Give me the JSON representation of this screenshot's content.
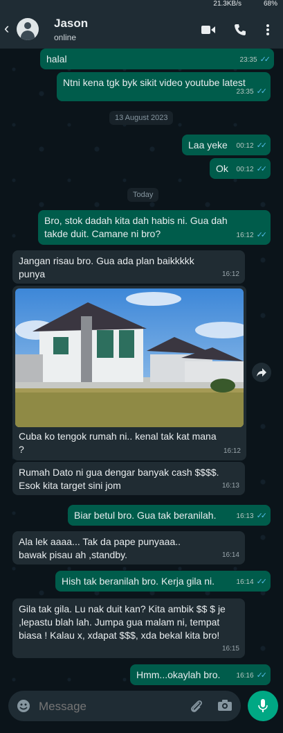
{
  "status_bar": {
    "network": "21.3KB/s",
    "battery": "68%"
  },
  "header": {
    "name": "Jason",
    "status": "online"
  },
  "messages": [
    {
      "dir": "out",
      "text": "halal",
      "time": "23:35"
    },
    {
      "dir": "out",
      "text": "Ntni kena tgk byk sikit video youtube latest",
      "time": "23:35"
    },
    {
      "dir": "out",
      "text": "Laa yeke",
      "time": "00:12"
    },
    {
      "dir": "out",
      "text": "Ok",
      "time": "00:12"
    },
    {
      "dir": "out",
      "text": "Bro, stok dadah kita dah habis ni. Gua dah takde duit. Camane ni bro?",
      "time": "16:12"
    },
    {
      "dir": "in",
      "text": "Jangan risau bro. Gua ada plan baikkkkk punya",
      "time": "16:12"
    },
    {
      "dir": "in",
      "text": "Cuba ko tengok rumah ni.. kenal tak kat mana ?",
      "time": "16:12"
    },
    {
      "dir": "in",
      "text": "Rumah Dato ni gua dengar banyak cash $$$$. Esok kita target sini jom",
      "time": "16:13"
    },
    {
      "dir": "out",
      "text": "Biar betul bro. Gua tak beranilah.",
      "time": "16:13"
    },
    {
      "dir": "in",
      "text": "Ala lek aaaa... Tak da pape punyaaa.. bawak pisau ah ,standby.",
      "time": "16:14"
    },
    {
      "dir": "out",
      "text": "Hish tak beranilah bro. Kerja gila ni.",
      "time": "16:14"
    },
    {
      "dir": "in",
      "text": "Gila tak gila. Lu nak duit kan? Kita ambik $$ $ je ,lepastu blah lah. Jumpa gua malam ni, tempat biasa ! Kalau x, xdapat $$$, xda bekal kita bro!",
      "time": "16:15"
    },
    {
      "dir": "out",
      "text": "Hmm...okaylah bro.",
      "time": "16:16"
    }
  ],
  "dates": {
    "d1": "13 August 2023",
    "d2": "Today"
  },
  "input": {
    "placeholder": "Message"
  },
  "icons": [
    "back-arrow-icon",
    "video-call-icon",
    "phone-icon",
    "more-icon",
    "forward-icon",
    "emoji-icon",
    "attach-icon",
    "camera-icon",
    "mic-icon"
  ],
  "colors": {
    "outgoing": "#005c4b",
    "incoming": "#202c33",
    "accent": "#00a884",
    "read_tick": "#53bdeb"
  }
}
